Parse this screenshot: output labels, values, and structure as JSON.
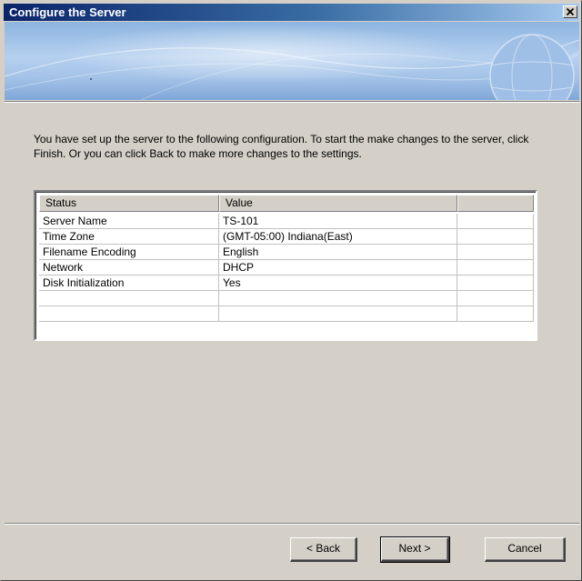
{
  "window": {
    "title": "Configure the Server",
    "close_glyph": "✕"
  },
  "message": "You have set up the server to the following configuration.  To start the make changes to the server, click Finish. Or you can click Back to make more changes to the settings.",
  "table": {
    "columns": [
      "Status",
      "Value",
      ""
    ],
    "rows": [
      [
        "Server Name",
        "TS-101",
        ""
      ],
      [
        "Time Zone",
        "(GMT-05:00) Indiana(East)",
        ""
      ],
      [
        "Filename Encoding",
        "English",
        ""
      ],
      [
        "Network",
        "DHCP",
        ""
      ],
      [
        "Disk Initialization",
        "Yes",
        ""
      ],
      [
        "",
        "",
        ""
      ],
      [
        "",
        "",
        ""
      ]
    ]
  },
  "buttons": {
    "back": "< Back",
    "next": "Next >",
    "cancel": "Cancel"
  }
}
